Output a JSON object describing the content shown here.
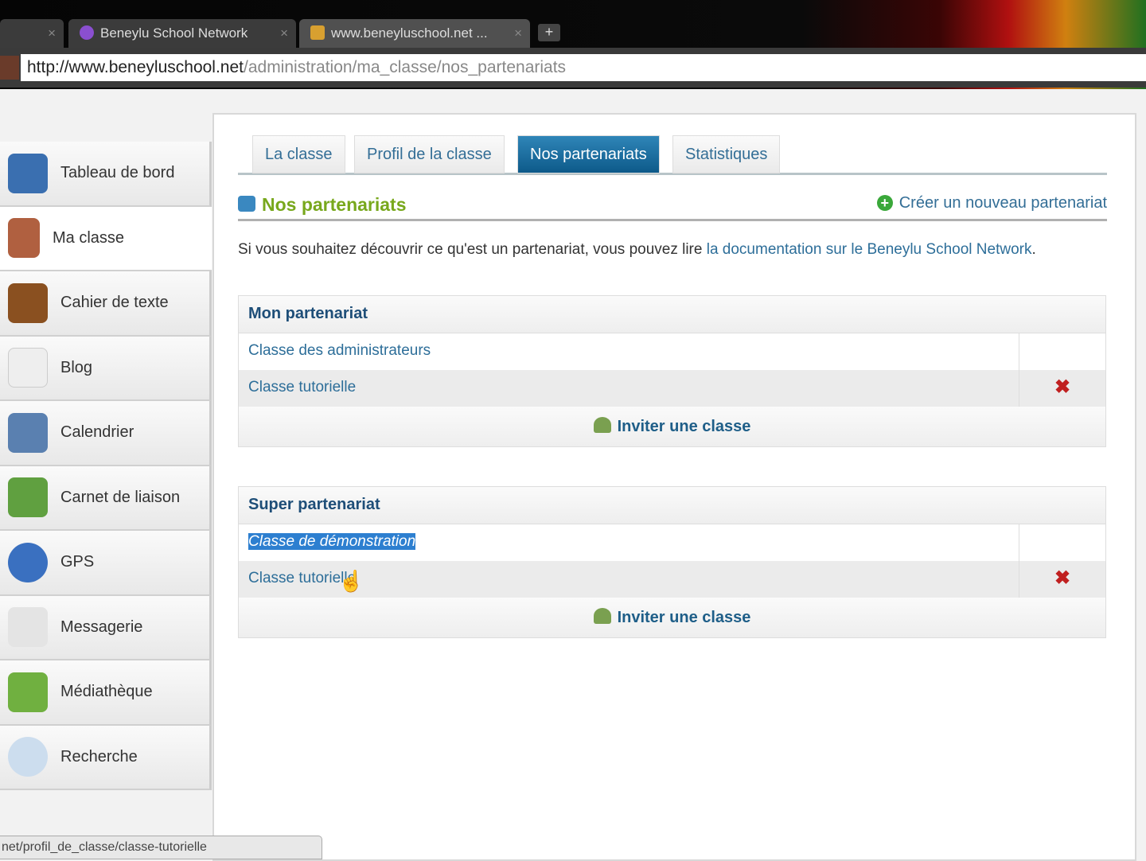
{
  "browser": {
    "tabs": [
      {
        "label": "Beneylu School Network"
      },
      {
        "label": "www.beneyluschool.net ..."
      }
    ],
    "url_domain": "http://www.beneyluschool.net",
    "url_path": "/administration/ma_classe/nos_partenariats",
    "status_url": "net/profil_de_classe/classe-tutorielle"
  },
  "sidebar": {
    "items": [
      {
        "label": "Tableau de bord"
      },
      {
        "label": "Ma classe"
      },
      {
        "label": "Cahier de texte"
      },
      {
        "label": "Blog"
      },
      {
        "label": "Calendrier"
      },
      {
        "label": "Carnet de liaison"
      },
      {
        "label": "GPS"
      },
      {
        "label": "Messagerie"
      },
      {
        "label": "Médiathèque"
      },
      {
        "label": "Recherche"
      }
    ]
  },
  "main": {
    "tabs": [
      {
        "label": "La classe"
      },
      {
        "label": "Profil de la classe"
      },
      {
        "label": "Nos partenariats"
      },
      {
        "label": "Statistiques"
      }
    ],
    "title": "Nos partenariats",
    "create_label": "Créer un nouveau partenariat",
    "intro_text": "Si vous souhaitez découvrir ce qu'est un partenariat, vous pouvez lire ",
    "intro_link": "la documentation sur le Beneylu School Network",
    "boxes": [
      {
        "title": "Mon partenariat",
        "rows": [
          "Classe des administrateurs",
          "Classe tutorielle"
        ],
        "invite": "Inviter une classe"
      },
      {
        "title": "Super partenariat",
        "rows": [
          "Classe de démonstration",
          "Classe tutorielle"
        ],
        "invite": "Inviter une classe"
      }
    ]
  },
  "delete_glyph": "✖"
}
